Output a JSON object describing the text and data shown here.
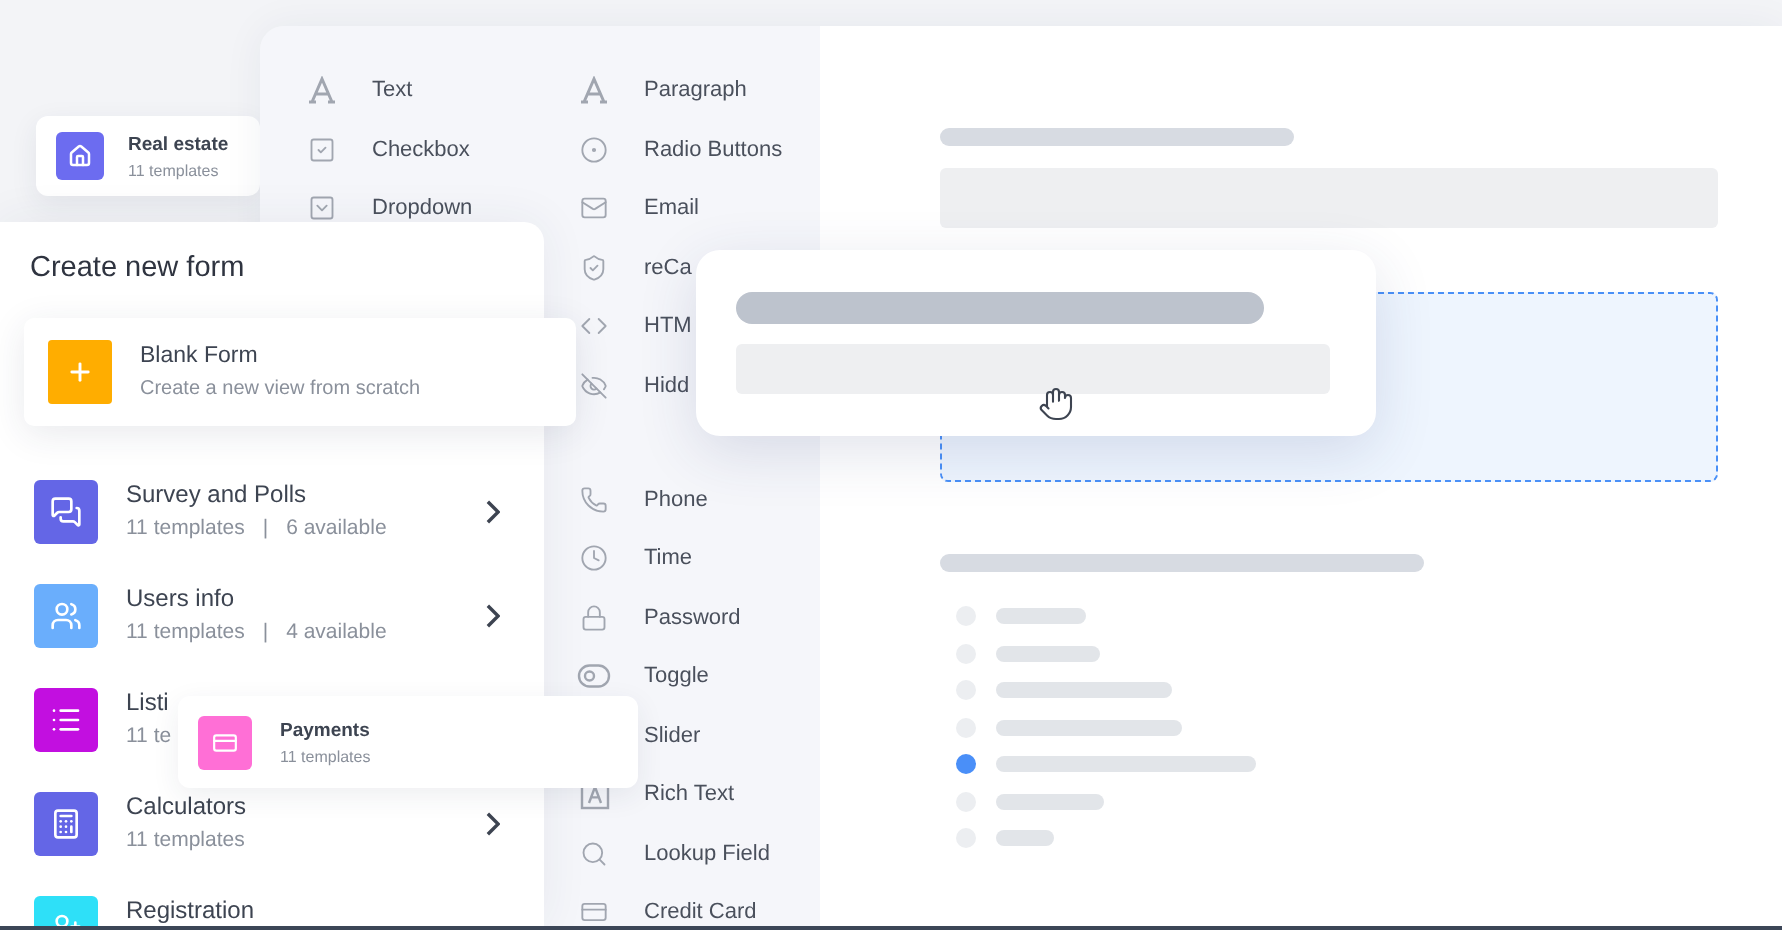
{
  "real_estate_card": {
    "title": "Real estate",
    "subtitle": "11 templates"
  },
  "fields_left": [
    {
      "label": "Text",
      "kind": "text"
    },
    {
      "label": "Checkbox",
      "kind": "checkbox"
    },
    {
      "label": "Dropdown",
      "kind": "dropdown"
    }
  ],
  "fields_right": [
    {
      "label": "Paragraph",
      "kind": "text"
    },
    {
      "label": "Radio Buttons",
      "kind": "radio"
    },
    {
      "label": "Email",
      "kind": "email"
    },
    {
      "label": "reCa",
      "kind": "captcha"
    },
    {
      "label": "HTM",
      "kind": "html"
    },
    {
      "label": "Hidd",
      "kind": "hidden"
    }
  ],
  "fields_lower": [
    {
      "label": "Phone",
      "kind": "phone"
    },
    {
      "label": "Time",
      "kind": "time"
    },
    {
      "label": "Password",
      "kind": "password"
    },
    {
      "label": "Toggle",
      "kind": "toggle"
    },
    {
      "label": "Slider",
      "kind": "slider"
    },
    {
      "label": "Rich Text",
      "kind": "richtext"
    },
    {
      "label": "Lookup Field",
      "kind": "lookup"
    },
    {
      "label": "Credit Card",
      "kind": "card"
    }
  ],
  "create_form": {
    "title": "Create new form",
    "blank": {
      "title": "Blank Form",
      "subtitle": "Create a new view from scratch"
    },
    "detail_separator": "|",
    "categories": [
      {
        "kind": "survey",
        "title": "Survey and Polls",
        "details": [
          "11 templates",
          "6 available"
        ],
        "color": "#6466e6",
        "chevron": true
      },
      {
        "kind": "users",
        "title": "Users info",
        "details": [
          "11 templates",
          "4 available"
        ],
        "color": "#6aaefc",
        "chevron": true
      },
      {
        "kind": "listings",
        "title": "Listi",
        "details": [
          "11 te"
        ],
        "color": "#c20fe0",
        "chevron": false
      },
      {
        "kind": "calculators",
        "title": "Calculators",
        "details": [
          "11 templates"
        ],
        "color": "#6466e6",
        "chevron": true
      },
      {
        "kind": "registration",
        "title": "Registration",
        "color": "#2ee0f8",
        "chevron": false
      }
    ]
  },
  "payments_card": {
    "title": "Payments",
    "subtitle": "11 templates"
  },
  "canvas": {
    "options": [
      {
        "selected": false
      },
      {
        "selected": false
      },
      {
        "selected": false
      },
      {
        "selected": false
      },
      {
        "selected": true
      },
      {
        "selected": false
      },
      {
        "selected": false
      }
    ]
  }
}
